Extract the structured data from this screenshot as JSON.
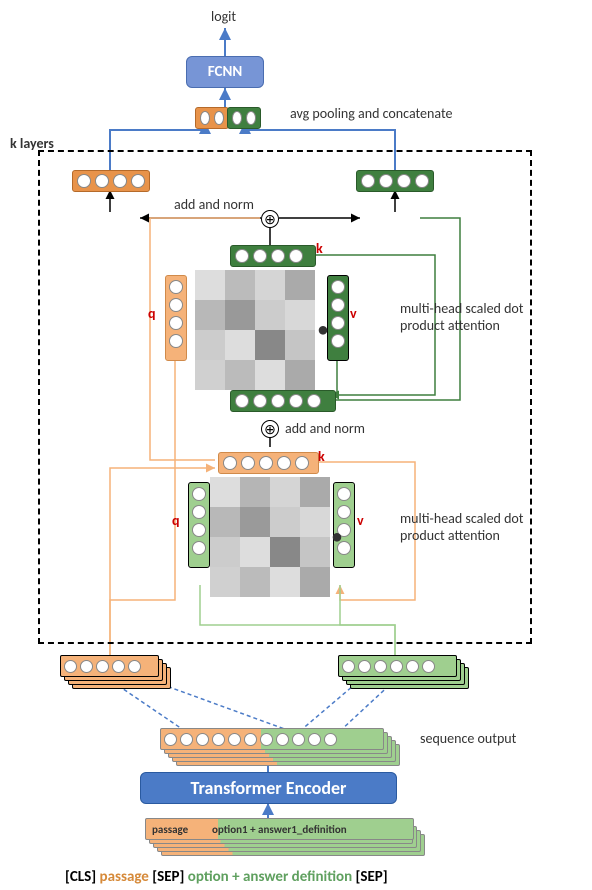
{
  "top": {
    "logit": "logit",
    "fcnn": "FCNN",
    "pool": "avg pooling and concatenate",
    "klayers": "k layers"
  },
  "mid": {
    "addnorm": "add and norm",
    "attn": "multi-head scaled dot product attention",
    "q": "q",
    "k": "k",
    "v": "v",
    "dot": "•"
  },
  "bottom": {
    "enc": "Transformer Encoder",
    "seqout": "sequence output",
    "passage": "passage",
    "opt": "option1 + answer1_definition"
  },
  "caption": {
    "cls": "[CLS] ",
    "p": "passage",
    "sep1": " [SEP] ",
    "opt": "option + answer definition",
    "sep2": " [SEP]"
  },
  "colors": {
    "orange": "#e8934a",
    "green": "#3f7f3f",
    "lgreen": "#9fcf8f",
    "blue": "#4b7bc7"
  }
}
